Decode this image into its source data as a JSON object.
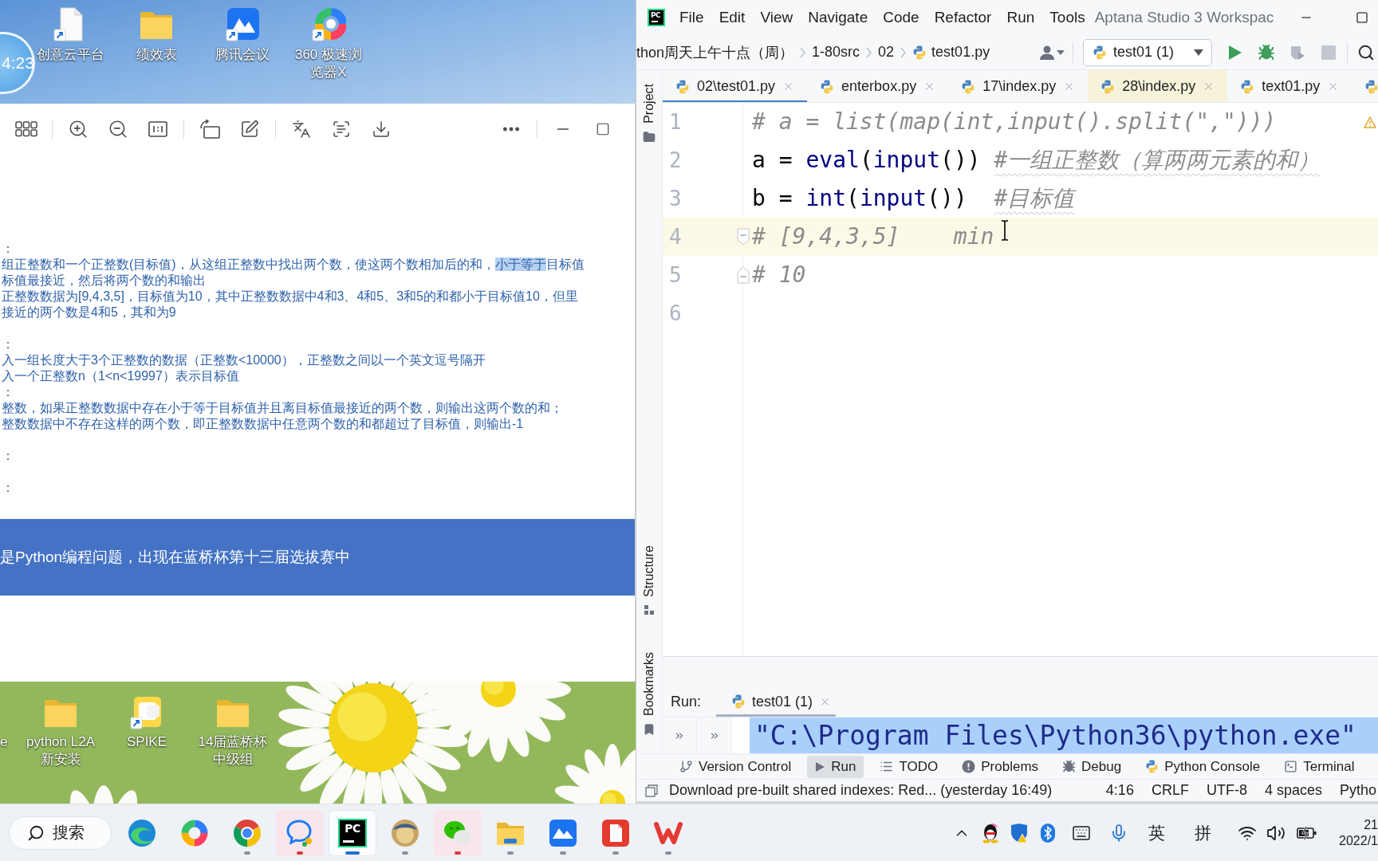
{
  "desktop": {
    "clock": "4:23",
    "top_icons": [
      {
        "label": "创意云平台",
        "kind": "document",
        "shortcut": true
      },
      {
        "label": "绩效表",
        "kind": "folder",
        "shortcut": false
      },
      {
        "label": "腾讯会议",
        "kind": "meeting",
        "shortcut": true
      },
      {
        "label": "360 极速浏览器X",
        "kind": "ring",
        "shortcut": true
      }
    ],
    "bottom_icons": [
      {
        "label": "e",
        "kind": "none"
      },
      {
        "label": "python L2A 新安装",
        "kind": "folder",
        "shortcut": false
      },
      {
        "label": "SPIKE",
        "kind": "app",
        "shortcut": true
      },
      {
        "label": "14届蓝桥杯中级组",
        "kind": "folder",
        "shortcut": false
      }
    ]
  },
  "viewer": {
    "document": {
      "sections": [
        {
          "lines": [
            {
              "segments": [
                {
                  "text": "：",
                  "selected": false
                }
              ]
            },
            {
              "segments": [
                {
                  "text": "组正整数和一个正整数(目标值)，从这组正整数中找出两个数，使这两个数相加后的和，",
                  "selected": false
                },
                {
                  "text": "小于等于",
                  "selected": true
                },
                {
                  "text": "目标值",
                  "selected": false
                }
              ]
            },
            {
              "segments": [
                {
                  "text": "标值最接近，然后将两个数的和输出",
                  "selected": false
                }
              ]
            },
            {
              "segments": [
                {
                  "text": "正整数数据为[9,4,3,5]，目标值为10，其中正整数数据中4和3、4和5、3和5的和都小于目标值10，但里",
                  "selected": false
                }
              ]
            },
            {
              "segments": [
                {
                  "text": "接近的两个数是4和5，其和为9",
                  "selected": false
                }
              ]
            }
          ]
        },
        {
          "lines": [
            {
              "segments": [
                {
                  "text": "：",
                  "selected": false
                }
              ]
            },
            {
              "segments": [
                {
                  "text": "入一组长度大于3个正整数的数据（正整数<10000），正整数之间以一个英文逗号隔开",
                  "selected": false
                }
              ]
            },
            {
              "segments": [
                {
                  "text": "入一个正整数n（1<n<19997）表示目标值",
                  "selected": false
                }
              ]
            },
            {
              "segments": [
                {
                  "text": "：",
                  "selected": false
                }
              ]
            },
            {
              "segments": [
                {
                  "text": "整数，如果正整数数据中存在小于等于目标值并且离目标值最接近的两个数，则输出这两个数的和；",
                  "selected": false
                }
              ]
            },
            {
              "segments": [
                {
                  "text": "整数数据中不存在这样的两个数，即正整数数据中任意两个数的和都超过了目标值，则输出-1",
                  "selected": false
                }
              ]
            }
          ]
        },
        {
          "lines": [
            {
              "segments": [
                {
                  "text": "：",
                  "selected": false
                }
              ]
            }
          ]
        },
        {
          "lines": [
            {
              "segments": [
                {
                  "text": "：",
                  "selected": false
                }
              ]
            }
          ]
        }
      ]
    },
    "banner": "是Python编程问题，出现在蓝桥杯第十三届选拔赛中"
  },
  "ide": {
    "logo": "PC",
    "menu": [
      "File",
      "Edit",
      "View",
      "Navigate",
      "Code",
      "Refactor",
      "Run",
      "Tools"
    ],
    "title": "Aptana Studio 3 Workspac",
    "breadcrumbs": [
      {
        "label": "thon周天上午十点（周）",
        "kind": "dir"
      },
      {
        "label": "1-80src",
        "kind": "dir"
      },
      {
        "label": "02",
        "kind": "dir"
      },
      {
        "label": "test01.py",
        "kind": "file"
      }
    ],
    "run_config": "test01 (1)",
    "tabs": [
      {
        "label": "02\\test01.py",
        "selected": true,
        "tinted": false
      },
      {
        "label": "enterbox.py",
        "selected": false,
        "tinted": false
      },
      {
        "label": "17\\index.py",
        "selected": false,
        "tinted": false
      },
      {
        "label": "28\\index.py",
        "selected": false,
        "tinted": true
      },
      {
        "label": "text01.py",
        "selected": false,
        "tinted": false
      },
      {
        "selected": false,
        "tinted": false
      }
    ],
    "side_tools": {
      "top": [
        {
          "label": "Project",
          "kind": "project"
        }
      ],
      "bottom": [
        {
          "label": "Structure",
          "kind": "structure"
        },
        {
          "label": "Bookmarks",
          "kind": "bookmarks"
        }
      ]
    },
    "editor": {
      "warnings": true,
      "lines": [
        {
          "number": "1",
          "current": false,
          "fold_start": false,
          "fold_end": false,
          "tokens": [
            {
              "kind": "comment",
              "text": "# a = list(map(int,input().split(\",\")))"
            }
          ]
        },
        {
          "number": "2",
          "current": false,
          "fold_start": false,
          "fold_end": false,
          "tokens": [
            {
              "kind": "code",
              "text": "a = "
            },
            {
              "kind": "builtin",
              "text": "eval"
            },
            {
              "kind": "code",
              "text": "("
            },
            {
              "kind": "builtin",
              "text": "input"
            },
            {
              "kind": "code",
              "text": "()) "
            },
            {
              "kind": "flagged",
              "text": "#一组正整数（算两两元素的和）"
            }
          ]
        },
        {
          "number": "3",
          "current": false,
          "fold_start": false,
          "fold_end": false,
          "tokens": [
            {
              "kind": "code",
              "text": "b = "
            },
            {
              "kind": "builtin",
              "text": "int"
            },
            {
              "kind": "code",
              "text": "("
            },
            {
              "kind": "builtin",
              "text": "input"
            },
            {
              "kind": "code",
              "text": "())  "
            },
            {
              "kind": "flagged",
              "text": "#目标值"
            }
          ]
        },
        {
          "number": "4",
          "current": true,
          "fold_start": true,
          "fold_end": false,
          "tokens": [
            {
              "kind": "comment",
              "text": "# [9,4,3,5]    min"
            }
          ]
        },
        {
          "number": "5",
          "current": false,
          "fold_start": false,
          "fold_end": true,
          "tokens": [
            {
              "kind": "comment",
              "text": "# 10"
            }
          ]
        },
        {
          "number": "6",
          "current": false,
          "fold_start": false,
          "fold_end": false
        }
      ]
    },
    "run_panel": {
      "label": "Run:",
      "tab": {
        "label": "test01 (1)",
        "selected": true
      },
      "console": {
        "text": "\"C:\\Program Files\\Python36\\python.exe\"",
        "selected": true
      }
    },
    "tool_windows": [
      {
        "label": "Version Control",
        "kind": "vcs",
        "selected": false
      },
      {
        "label": "Run",
        "kind": "run",
        "selected": true
      },
      {
        "label": "TODO",
        "kind": "todo",
        "selected": false
      },
      {
        "label": "Problems",
        "kind": "problems",
        "selected": false
      },
      {
        "label": "Debug",
        "kind": "debug",
        "selected": false
      },
      {
        "label": "Python Console",
        "kind": "console",
        "selected": false
      },
      {
        "label": "Terminal",
        "kind": "terminal",
        "selected": false
      }
    ],
    "status": {
      "message": "Download pre-built shared indexes: Red... (yesterday 16:49)",
      "items": [
        "4:16",
        "CRLF",
        "UTF-8",
        "4 spaces",
        "Pytho"
      ]
    }
  },
  "taskbar": {
    "search": "搜索",
    "apps": [
      {
        "kind": "swirl",
        "running": false,
        "attention": false,
        "focused": false
      },
      {
        "kind": "ring",
        "running": false,
        "attention": false,
        "focused": false
      },
      {
        "kind": "wheel",
        "running": true,
        "attention": false,
        "focused": false
      },
      {
        "kind": "chat",
        "running": true,
        "attention": true,
        "focused": false
      },
      {
        "kind": "ide",
        "running": true,
        "attention": false,
        "focused": true,
        "badge": "PC"
      },
      {
        "kind": "avatar",
        "running": true,
        "attention": false,
        "focused": false
      },
      {
        "kind": "bubbles",
        "running": true,
        "attention": true,
        "focused": false
      },
      {
        "kind": "folder",
        "running": true,
        "attention": false,
        "focused": false
      },
      {
        "kind": "mountain",
        "running": true,
        "attention": false,
        "focused": false
      },
      {
        "kind": "document",
        "running": true,
        "attention": false,
        "focused": false
      },
      {
        "kind": "zigzag",
        "running": true,
        "attention": false,
        "focused": false
      }
    ],
    "tray": {
      "language": "英",
      "input_mode": "拼",
      "time": "21",
      "date": "2022/1"
    }
  }
}
